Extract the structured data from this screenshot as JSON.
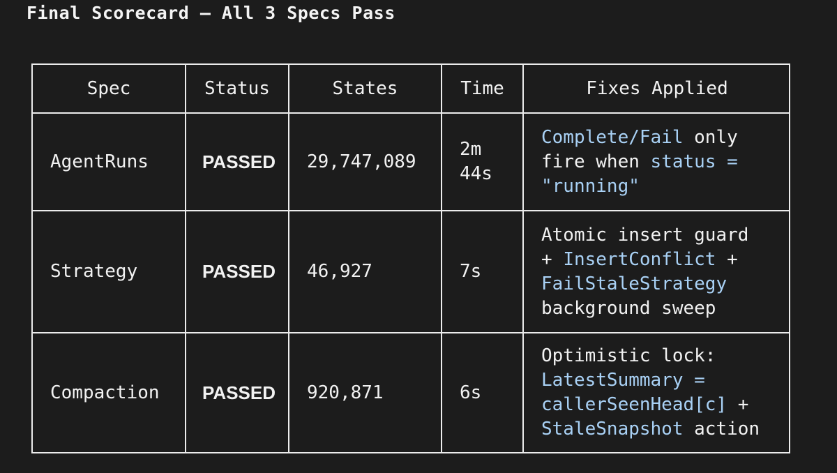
{
  "title": "Final Scorecard — All 3 Specs Pass",
  "table": {
    "headers": [
      "Spec",
      "Status",
      "States",
      "Time",
      "Fixes Applied"
    ],
    "rows": [
      {
        "spec": "AgentRuns",
        "status": "PASSED",
        "states": "29,747,089",
        "time_lines": [
          "2m",
          "44s"
        ],
        "fixes_lines": [
          [
            {
              "t": "Complete/Fail",
              "hl": true
            },
            {
              "t": " only",
              "hl": false
            }
          ],
          [
            {
              "t": "fire when ",
              "hl": false
            },
            {
              "t": "status =",
              "hl": true
            }
          ],
          [
            {
              "t": "\"running\"",
              "hl": true
            }
          ]
        ]
      },
      {
        "spec": "Strategy",
        "status": "PASSED",
        "states": "46,927",
        "time_lines": [
          "7s"
        ],
        "fixes_lines": [
          [
            {
              "t": "Atomic insert guard",
              "hl": false
            }
          ],
          [
            {
              "t": "+ ",
              "hl": false
            },
            {
              "t": "InsertConflict",
              "hl": true
            },
            {
              "t": " +",
              "hl": false
            }
          ],
          [
            {
              "t": "FailStaleStrategy",
              "hl": true
            }
          ],
          [
            {
              "t": "background sweep",
              "hl": false
            }
          ]
        ]
      },
      {
        "spec": "Compaction",
        "status": "PASSED",
        "states": "920,871",
        "time_lines": [
          "6s"
        ],
        "fixes_lines": [
          [
            {
              "t": "Optimistic lock:",
              "hl": false
            }
          ],
          [
            {
              "t": "LatestSummary =",
              "hl": true
            }
          ],
          [
            {
              "t": "callerSeenHead[c]",
              "hl": true
            },
            {
              "t": " +",
              "hl": false
            }
          ],
          [
            {
              "t": "StaleSnapshot",
              "hl": true
            },
            {
              "t": " action",
              "hl": false
            }
          ]
        ]
      }
    ]
  },
  "colors": {
    "background": "#1c1c1c",
    "text": "#f2f2f2",
    "highlight": "#a9d1f5",
    "grid": "#ececec"
  }
}
